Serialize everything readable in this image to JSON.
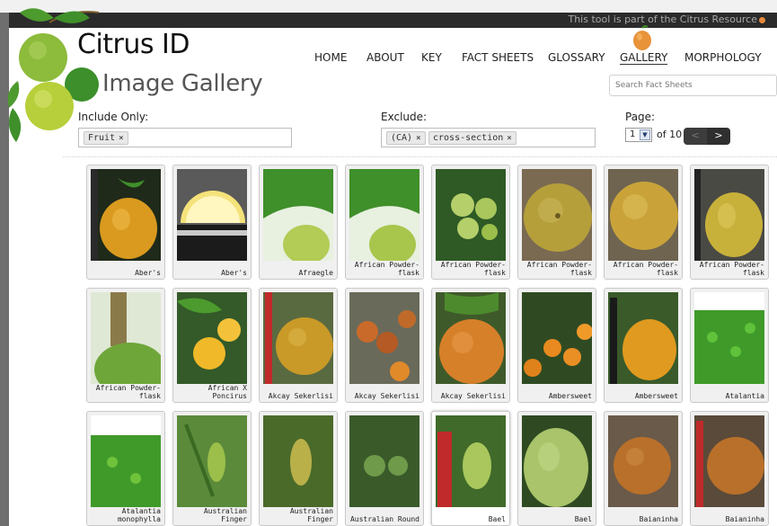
{
  "topbar": {
    "text": "This tool is part of the Citrus Resource"
  },
  "brand": {
    "title": "Citrus ID",
    "subtitle": "Image Gallery"
  },
  "nav": {
    "items": [
      "HOME",
      "ABOUT",
      "KEY",
      "FACT SHEETS",
      "GLOSSARY",
      "GALLERY",
      "MORPHOLOGY"
    ],
    "active": "GALLERY"
  },
  "search": {
    "placeholder": "Search Fact Sheets"
  },
  "filters": {
    "include_label": "Include Only:",
    "include_chips": [
      "Fruit"
    ],
    "exclude_label": "Exclude:",
    "exclude_chips": [
      "(CA)",
      "cross-section"
    ],
    "page_label": "Page:",
    "page_value": "1",
    "page_of": "of 10",
    "prev_label": "<",
    "next_label": ">"
  },
  "gallery": {
    "items": [
      {
        "caption": "Aber's"
      },
      {
        "caption": "Aber's"
      },
      {
        "caption": "Afraegle"
      },
      {
        "caption": "African Powder-flask"
      },
      {
        "caption": "African Powder-flask"
      },
      {
        "caption": "African Powder-flask"
      },
      {
        "caption": "African Powder-flask"
      },
      {
        "caption": "African Powder-flask"
      },
      {
        "caption": "African Powder-flask"
      },
      {
        "caption": "African X Poncirus"
      },
      {
        "caption": "Akcay Sekerlisi"
      },
      {
        "caption": "Akcay Sekerlisi"
      },
      {
        "caption": "Akcay Sekerlisi"
      },
      {
        "caption": "Ambersweet"
      },
      {
        "caption": "Ambersweet"
      },
      {
        "caption": "Atalantia"
      },
      {
        "caption": "Atalantia monophylla"
      },
      {
        "caption": "Australian Finger"
      },
      {
        "caption": "Australian Finger"
      },
      {
        "caption": "Australian Round"
      },
      {
        "caption": "Bael"
      },
      {
        "caption": "Bael"
      },
      {
        "caption": "Baianinha"
      },
      {
        "caption": "Baianinha"
      }
    ]
  },
  "colors": {
    "topbar": "#2b2b2b",
    "accent_orange": "#e8893a",
    "thumb_bg": "#f0f0f0",
    "leaf_green": "#3f8f2a",
    "fruit_orange": "#d89a2a",
    "fruit_green": "#9bbf4a"
  }
}
